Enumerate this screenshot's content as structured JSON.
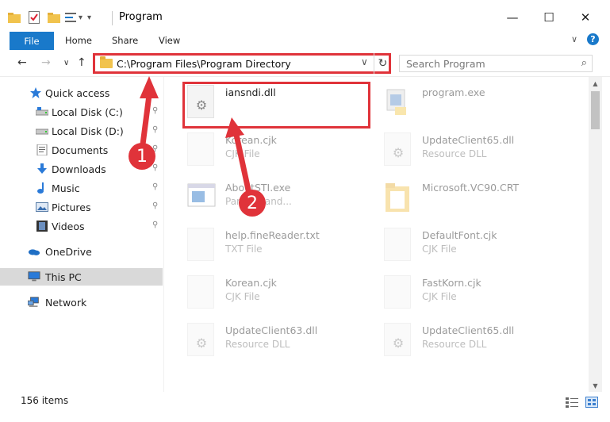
{
  "window": {
    "title": "Program",
    "qa_undo": "▾",
    "minimize": "—",
    "maximize": "☐",
    "close": "✕"
  },
  "ribbon": {
    "tabs": [
      "File",
      "Home",
      "Share",
      "View"
    ],
    "expand_chevron": "∨",
    "help": "?"
  },
  "nav": {
    "back": "←",
    "forward": "→",
    "recent": "∨",
    "up": "↑",
    "address": "C:\\Program Files\\Program Directory",
    "address_chevron": "∨",
    "refresh": "↻",
    "search_placeholder": "Search Program",
    "search_glyph": "⌕"
  },
  "sidebar": {
    "items": [
      {
        "label": "Quick access",
        "icon": "star-icon",
        "pinned": false
      },
      {
        "label": "Local Disk (C:)",
        "icon": "drive-icon",
        "pinned": true
      },
      {
        "label": "Local Disk (D:)",
        "icon": "drive-icon",
        "pinned": true
      },
      {
        "label": "Documents",
        "icon": "documents-icon",
        "pinned": true
      },
      {
        "label": "Downloads",
        "icon": "download-icon",
        "pinned": true
      },
      {
        "label": "Music",
        "icon": "music-icon",
        "pinned": true
      },
      {
        "label": "Pictures",
        "icon": "pictures-icon",
        "pinned": true
      },
      {
        "label": "Videos",
        "icon": "videos-icon",
        "pinned": true
      },
      {
        "label": "OneDrive",
        "icon": "cloud-icon",
        "pinned": false
      },
      {
        "label": "This PC",
        "icon": "computer-icon",
        "pinned": false,
        "selected": true
      },
      {
        "label": "Network",
        "icon": "network-icon",
        "pinned": false
      }
    ],
    "pin_glyph": "📌"
  },
  "files": [
    {
      "name": "iansndi.dll",
      "type": "",
      "icon": "gear-file-icon",
      "highlighted": true
    },
    {
      "name": "program.exe",
      "type": "",
      "icon": "exe-icon"
    },
    {
      "name": "Korean.cjk",
      "type": "CJK File",
      "icon": "blank-file-icon"
    },
    {
      "name": "UpdateClient65.dll",
      "type": "Resource DLL",
      "icon": "gear-file-icon"
    },
    {
      "name": "AboutSTI.exe",
      "type": "Parent hand...",
      "icon": "window-icon"
    },
    {
      "name": "Microsoft.VC90.CRT",
      "type": "",
      "icon": "folder-icon"
    },
    {
      "name": "help.fineReader.txt",
      "type": "TXT File",
      "icon": "blank-file-icon"
    },
    {
      "name": "DefaultFont.cjk",
      "type": "CJK File",
      "icon": "blank-file-icon"
    },
    {
      "name": "Korean.cjk",
      "type": "CJK File",
      "icon": "blank-file-icon"
    },
    {
      "name": "FastKorn.cjk",
      "type": "CJK File",
      "icon": "blank-file-icon"
    },
    {
      "name": "UpdateClient63.dll",
      "type": "Resource DLL",
      "icon": "gear-file-icon"
    },
    {
      "name": "UpdateClient65.dll",
      "type": "Resource DLL",
      "icon": "gear-file-icon"
    }
  ],
  "status": {
    "items_count": "156 items"
  },
  "annotations": {
    "marker1": "1",
    "marker2": "2",
    "color": "#e0333a"
  },
  "colors": {
    "accent": "#1979ca",
    "highlight": "#e0333a",
    "folder": "#f1c34d"
  }
}
